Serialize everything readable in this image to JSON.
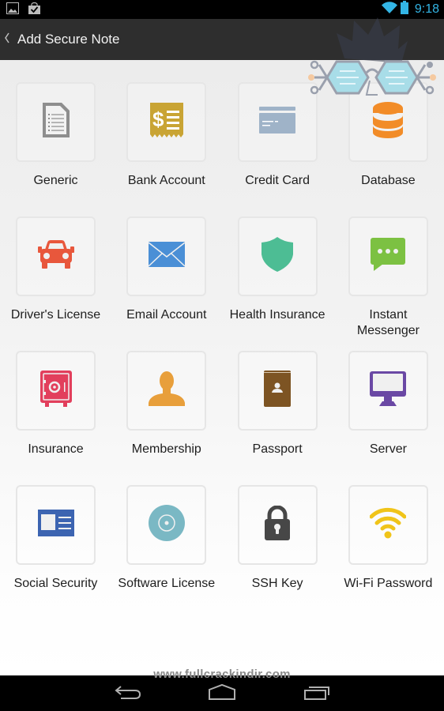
{
  "status_bar": {
    "notification_icons": [
      "image-icon",
      "shopping-bag-check-icon"
    ],
    "wifi_icon": "wifi-icon",
    "battery_icon": "battery-icon",
    "time": "9:18",
    "accent_color": "#33b5e5"
  },
  "action_bar": {
    "back_icon": "chevron-left-icon",
    "title": "Add Secure Note"
  },
  "note_types": [
    {
      "label": "Generic",
      "icon": "document-icon",
      "color": "#8e8e8e"
    },
    {
      "label": "Bank Account",
      "icon": "receipt-dollar-icon",
      "color": "#c9a434"
    },
    {
      "label": "Credit Card",
      "icon": "credit-card-icon",
      "color": "#9fb3c8"
    },
    {
      "label": "Database",
      "icon": "database-icon",
      "color": "#f28c28"
    },
    {
      "label": "Driver's License",
      "icon": "car-icon",
      "color": "#e8573c"
    },
    {
      "label": "Email Account",
      "icon": "envelope-icon",
      "color": "#4a8fd6"
    },
    {
      "label": "Health Insurance",
      "icon": "shield-icon",
      "color": "#4dbd94"
    },
    {
      "label": "Instant Messenger",
      "icon": "chat-bubble-icon",
      "color": "#7cc142"
    },
    {
      "label": "Insurance",
      "icon": "safe-icon",
      "color": "#e23f5c"
    },
    {
      "label": "Membership",
      "icon": "person-icon",
      "color": "#e89f3b"
    },
    {
      "label": "Passport",
      "icon": "passport-icon",
      "color": "#7d5423"
    },
    {
      "label": "Server",
      "icon": "monitor-icon",
      "color": "#6a48a4"
    },
    {
      "label": "Social Security",
      "icon": "id-card-icon",
      "color": "#3c64b1"
    },
    {
      "label": "Software License",
      "icon": "disc-icon",
      "color": "#7ab8c4"
    },
    {
      "label": "SSH Key",
      "icon": "padlock-icon",
      "color": "#474747"
    },
    {
      "label": "Wi-Fi Password",
      "icon": "wifi-signal-icon",
      "color": "#f0c419"
    }
  ],
  "nav_bar": {
    "back": "back-arrow-icon",
    "home": "home-icon",
    "recents": "recent-apps-icon"
  },
  "watermark": {
    "url_text": "www.fullcrackindir.com"
  }
}
